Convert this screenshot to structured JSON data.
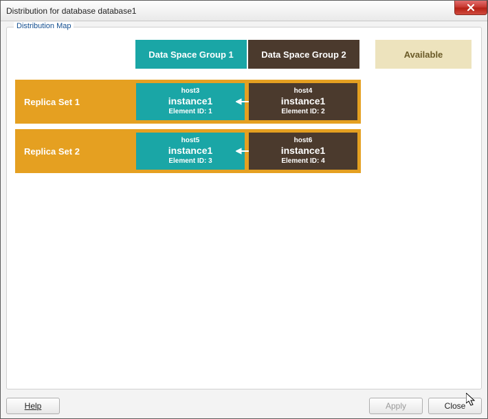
{
  "window": {
    "title": "Distribution for database database1",
    "fieldset_legend": "Distribution Map"
  },
  "headers": {
    "group1": "Data Space Group 1",
    "group2": "Data Space Group 2",
    "available": "Available"
  },
  "replica_sets": [
    {
      "label": "Replica Set 1",
      "nodes": [
        {
          "host": "host3",
          "instance": "instance1",
          "element_id": "Element ID: 1"
        },
        {
          "host": "host4",
          "instance": "instance1",
          "element_id": "Element ID: 2"
        }
      ]
    },
    {
      "label": "Replica Set 2",
      "nodes": [
        {
          "host": "host5",
          "instance": "instance1",
          "element_id": "Element ID: 3"
        },
        {
          "host": "host6",
          "instance": "instance1",
          "element_id": "Element ID: 4"
        }
      ]
    }
  ],
  "buttons": {
    "help": "Help",
    "apply": "Apply",
    "close": "Close"
  },
  "colors": {
    "teal": "#1aa6a6",
    "brown": "#4b3a2d",
    "orange": "#e5a021",
    "available_bg": "#ede3bd"
  }
}
